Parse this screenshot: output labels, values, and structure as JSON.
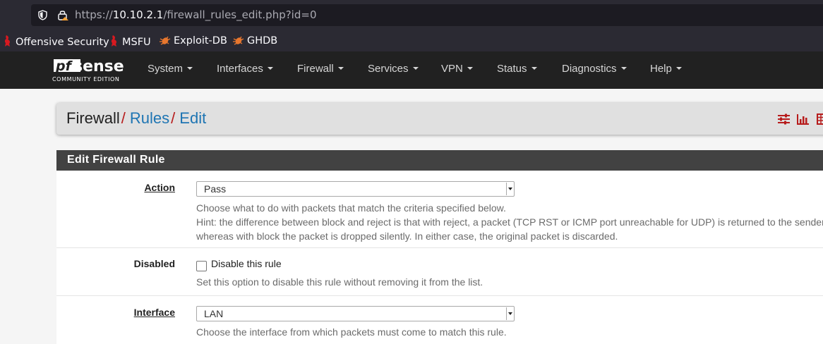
{
  "browser": {
    "url_prefix": "https://",
    "url_host": "10.10.2.1",
    "url_path": "/firewall_rules_edit.php?id=0",
    "bookmarks": [
      {
        "label": "Offensive Security",
        "icon": "offsec-dragon-icon"
      },
      {
        "label": "MSFU",
        "icon": "offsec-dragon-icon"
      },
      {
        "label": "Exploit-DB",
        "icon": "exploitdb-bug-icon"
      },
      {
        "label": "GHDB",
        "icon": "exploitdb-bug-icon"
      }
    ]
  },
  "navbar": {
    "brand_logo": "pfsense",
    "brand_edition": "COMMUNITY EDITION",
    "items": [
      {
        "label": "System"
      },
      {
        "label": "Interfaces"
      },
      {
        "label": "Firewall"
      },
      {
        "label": "Services"
      },
      {
        "label": "VPN"
      },
      {
        "label": "Status"
      },
      {
        "label": "Diagnostics"
      },
      {
        "label": "Help"
      }
    ]
  },
  "breadcrumb": {
    "root": "Firewall",
    "separator": "/",
    "rules": "Rules",
    "current": "Edit",
    "icons": [
      "sliders-icon",
      "bar-chart-icon",
      "table-icon"
    ]
  },
  "panel": {
    "title": "Edit Firewall Rule",
    "action": {
      "label": "Action",
      "value": "Pass",
      "help_1": "Choose what to do with packets that match the criteria specified below.",
      "help_2": "Hint: the difference between block and reject is that with reject, a packet (TCP RST or ICMP port unreachable for UDP) is returned to the sender,",
      "help_3": "whereas with block the packet is dropped silently. In either case, the original packet is discarded."
    },
    "disabled": {
      "label": "Disabled",
      "checkbox_label": "Disable this rule",
      "checked": false,
      "help": "Set this option to disable this rule without removing it from the list."
    },
    "interface": {
      "label": "Interface",
      "value": "LAN",
      "help": "Choose the interface from which packets must come to match this rule."
    }
  },
  "colors": {
    "navbar_bg": "#212121",
    "panel_header_bg": "#424242",
    "breadcrumb_link": "#1e75b3",
    "breadcrumb_separator": "#b71c1c",
    "accent_red": "#b71c1c"
  }
}
